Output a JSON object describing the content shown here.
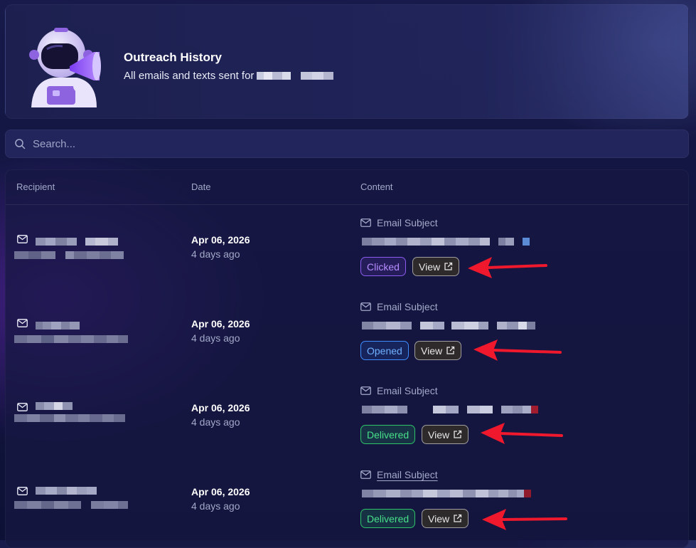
{
  "header": {
    "title": "Outreach History",
    "subtitle": "All emails and texts sent for"
  },
  "search": {
    "placeholder": "Search..."
  },
  "table": {
    "columns": [
      "Recipient",
      "Date",
      "Content"
    ]
  },
  "rows": [
    {
      "date": "Apr 06, 2026",
      "ago": "4 days ago",
      "subject_label": "Email Subject",
      "status": "Clicked",
      "view_label": "View"
    },
    {
      "date": "Apr 06, 2026",
      "ago": "4 days ago",
      "subject_label": "Email Subject",
      "status": "Opened",
      "view_label": "View"
    },
    {
      "date": "Apr 06, 2026",
      "ago": "4 days ago",
      "subject_label": "Email Subject",
      "status": "Delivered",
      "view_label": "View"
    },
    {
      "date": "Apr 06, 2026",
      "ago": "4 days ago",
      "subject_label": "Email Subject",
      "status": "Delivered",
      "view_label": "View"
    }
  ],
  "icons": {
    "search": "search-icon",
    "mail": "mail-icon",
    "external": "external-link-icon",
    "mascot": "astronaut-megaphone-icon",
    "annotation": "red-arrow-icon"
  },
  "colors": {
    "clicked": "#8a5cf0",
    "opened": "#3f8cff",
    "delivered": "#2fc46a",
    "annotation": "#f0182c"
  }
}
